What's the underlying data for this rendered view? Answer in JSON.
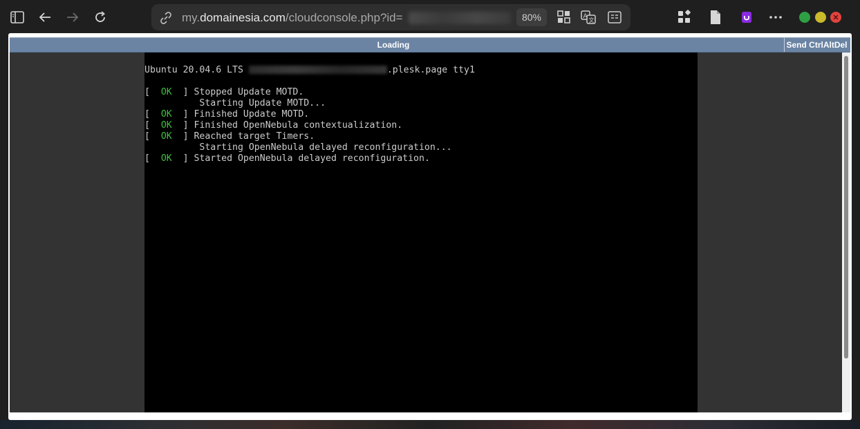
{
  "browser": {
    "url_prefix": "my.",
    "url_domain": "domainesia.com",
    "url_path": "/cloudconsole.php?id=",
    "zoom": "80%",
    "icons": {
      "sidebar": "sidebar-toggle-icon",
      "back": "back-arrow-icon",
      "forward": "forward-arrow-icon",
      "reload": "reload-icon",
      "site_info": "site-info-icon",
      "apps": "apps-icon",
      "translate": "translate-icon",
      "reader": "reader-mode-icon",
      "extensions": "extensions-icon",
      "page": "page-icon",
      "profile": "copilot-icon",
      "menu": "more-menu-icon"
    },
    "window_controls": {
      "minimize_color": "#2ea043",
      "maximize_color": "#c9b92b",
      "close_color": "#e0443e"
    }
  },
  "vnc": {
    "status": "Loading",
    "send_button": "Send CtrlAltDel"
  },
  "terminal": {
    "header": "Ubuntu 20.04.6 LTS ",
    "header_suffix": ".plesk.page tty1",
    "lines": [
      {
        "prefix": "[  ",
        "ok": "OK",
        "suffix": "  ] Stopped Update MOTD."
      },
      {
        "prefix": "          Starting Update MOTD...",
        "ok": "",
        "suffix": ""
      },
      {
        "prefix": "[  ",
        "ok": "OK",
        "suffix": "  ] Finished Update MOTD."
      },
      {
        "prefix": "[  ",
        "ok": "OK",
        "suffix": "  ] Finished OpenNebula contextualization."
      },
      {
        "prefix": "[  ",
        "ok": "OK",
        "suffix": "  ] Reached target Timers."
      },
      {
        "prefix": "          Starting OpenNebula delayed reconfiguration...",
        "ok": "",
        "suffix": ""
      },
      {
        "prefix": "[  ",
        "ok": "OK",
        "suffix": "  ] Started OpenNebula delayed reconfiguration."
      }
    ]
  }
}
